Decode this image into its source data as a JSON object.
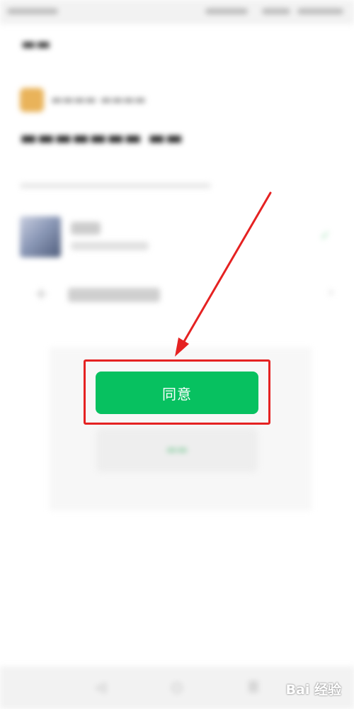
{
  "dialog": {
    "confirm_button": "同意"
  },
  "watermark": {
    "text": "Bai 经验"
  },
  "colors": {
    "confirm_button_bg": "#07c160",
    "highlight_box": "#e52222",
    "arrow": "#e52222"
  },
  "icons": [
    "app-logo-icon",
    "check-icon",
    "plus-icon",
    "chevron-right-icon",
    "nav-back-icon",
    "nav-home-icon",
    "nav-menu-icon"
  ]
}
